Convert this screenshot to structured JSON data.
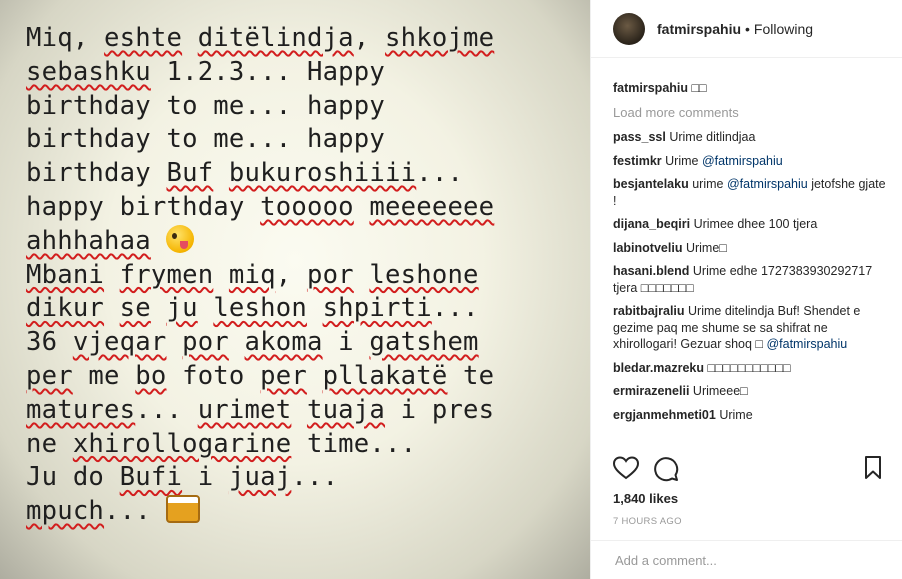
{
  "photo": {
    "lines": [
      [
        "Miq, ",
        {
          "w": "eshte"
        },
        " ",
        {
          "w": "ditëlindja"
        },
        ", ",
        {
          "w": "shkojme"
        }
      ],
      [
        {
          "w": "sebashku"
        },
        " 1.2.3... Happy"
      ],
      [
        "birthday to me... happy"
      ],
      [
        "birthday to me... happy"
      ],
      [
        "birthday ",
        {
          "w": "Buf"
        },
        " ",
        {
          "w": "bukuroshiiii"
        },
        "..."
      ],
      [
        "happy birthday ",
        {
          "w": "tooooo"
        },
        " ",
        {
          "w": "meeeeeee"
        }
      ],
      [
        {
          "w": "ahhhahaa"
        },
        " ",
        {
          "e": "face"
        }
      ],
      [
        {
          "w": "Mbani"
        },
        " ",
        {
          "w": "frymen"
        },
        " ",
        {
          "w": "miq"
        },
        ", ",
        {
          "w": "por"
        },
        " ",
        {
          "w": "leshone"
        }
      ],
      [
        {
          "w": "dikur"
        },
        " ",
        {
          "w": "se"
        },
        " ",
        {
          "w": "ju"
        },
        " ",
        {
          "w": "leshon"
        },
        " ",
        {
          "w": "shpirti"
        },
        "..."
      ],
      [
        "36 ",
        {
          "w": "vjeqar"
        },
        " ",
        {
          "w": "por"
        },
        " ",
        {
          "w": "akoma"
        },
        " i ",
        {
          "w": "gatshem"
        }
      ],
      [
        {
          "w": "per"
        },
        " me ",
        {
          "w": "bo"
        },
        " foto ",
        {
          "w": "per"
        },
        " ",
        {
          "w": "pllakatë"
        },
        " te"
      ],
      [
        {
          "w": "matures"
        },
        "... ",
        {
          "w": "urimet"
        },
        " ",
        {
          "w": "tuaja"
        },
        " i pres"
      ],
      [
        "ne ",
        {
          "w": "xhirollogarine"
        },
        " time..."
      ],
      [
        "Ju do ",
        {
          "w": "Bufi"
        },
        " i ",
        {
          "w": "juaj"
        },
        "..."
      ],
      [
        {
          "w": "mpuch"
        },
        "... ",
        {
          "e": "beer"
        }
      ]
    ]
  },
  "header": {
    "username": "fatmirspahiu",
    "separator": "•",
    "follow_label": "Following"
  },
  "caption": {
    "user": "fatmirspahiu",
    "text": "□□"
  },
  "load_more": "Load more comments",
  "comments": [
    {
      "user": "pass_ssl",
      "parts": [
        {
          "t": "Urime ditlindjaa"
        }
      ]
    },
    {
      "user": "festimkr",
      "parts": [
        {
          "t": "Urime "
        },
        {
          "m": "@fatmirspahiu"
        }
      ]
    },
    {
      "user": "besjantelaku",
      "parts": [
        {
          "t": "urime "
        },
        {
          "m": "@fatmirspahiu"
        },
        {
          "t": " jetofshe gjate !"
        }
      ]
    },
    {
      "user": "dijana_beqiri",
      "parts": [
        {
          "t": "Urimee dhee 100 tjera"
        }
      ]
    },
    {
      "user": "labinotveliu",
      "parts": [
        {
          "t": "Urime□"
        }
      ]
    },
    {
      "user": "hasani.blend",
      "parts": [
        {
          "t": "Urime edhe 1727383930292717 tjera □□□□□□□"
        }
      ]
    },
    {
      "user": "rabitbajraliu",
      "parts": [
        {
          "t": "Urime ditelindja Buf! Shendet e gezime paq me shume se sa shifrat ne xhirollogari! Gezuar shoq □ "
        },
        {
          "m": "@fatmirspahiu"
        }
      ]
    },
    {
      "user": "bledar.mazreku",
      "parts": [
        {
          "t": "□□□□□□□□□□□"
        }
      ]
    },
    {
      "user": "ermirazenelii",
      "parts": [
        {
          "t": "Urimeee□"
        }
      ]
    },
    {
      "user": "ergjanmehmeti01",
      "parts": [
        {
          "t": "Urime"
        }
      ]
    }
  ],
  "likes": "1,840 likes",
  "timestamp": "7 HOURS AGO",
  "add_comment": {
    "placeholder": "Add a comment..."
  },
  "icons": {
    "like": "heart-icon",
    "comment": "speech-bubble-icon",
    "save": "bookmark-icon"
  }
}
